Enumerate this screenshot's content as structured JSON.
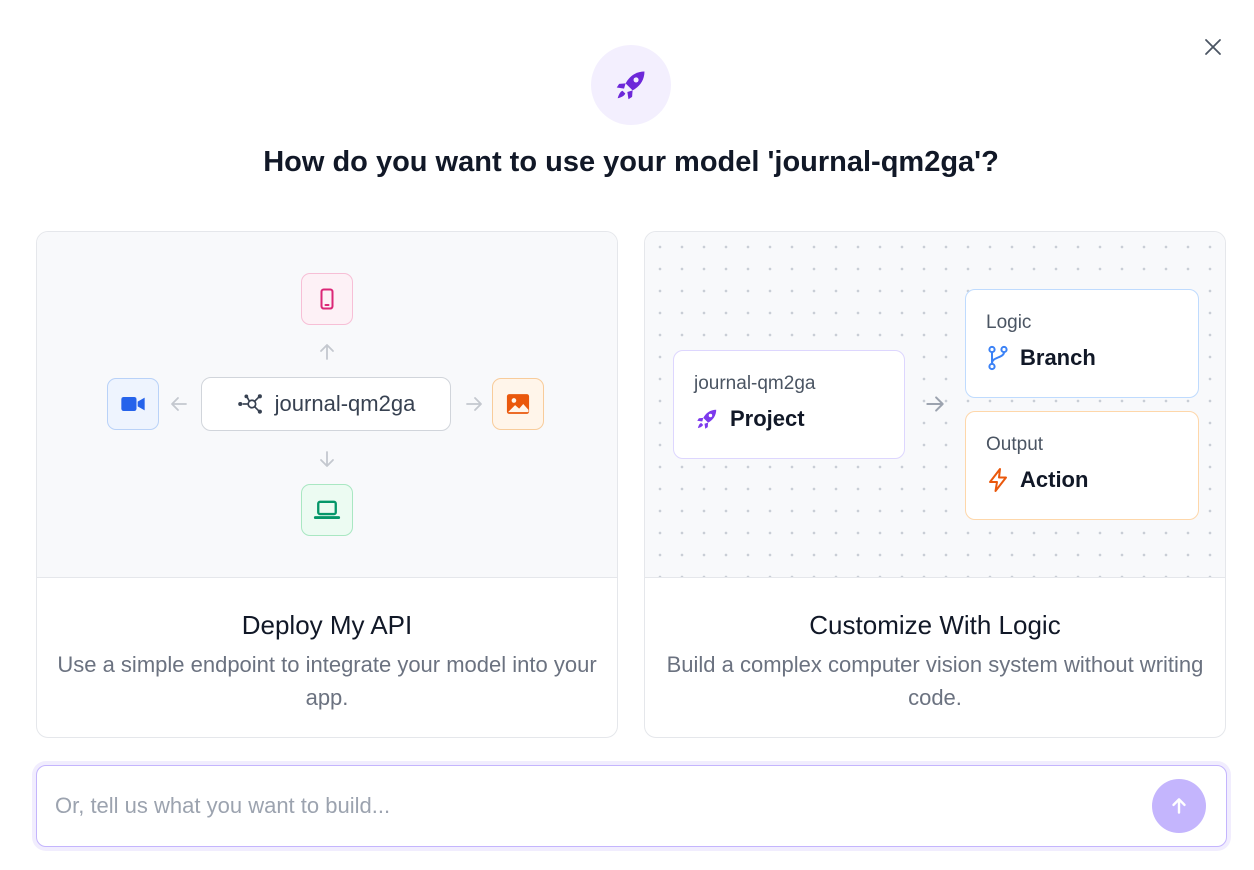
{
  "dialog": {
    "title": "How do you want to use your model 'journal-qm2ga'?",
    "icons": {
      "hero": "rocket-icon",
      "close": "close-icon"
    },
    "accent_color": "#6d28d9"
  },
  "cards": [
    {
      "title": "Deploy My API",
      "description": "Use a simple endpoint to integrate your model into your app.",
      "diagram": {
        "model_name": "journal-qm2ga",
        "targets": [
          "phone-icon",
          "video-camera-icon",
          "image-icon",
          "laptop-icon"
        ]
      }
    },
    {
      "title": "Customize With Logic",
      "description": "Build a complex computer vision system without writing code.",
      "diagram": {
        "project": {
          "subtitle": "journal-qm2ga",
          "label": "Project",
          "icon": "rocket-icon"
        },
        "branch": {
          "subtitle": "Logic",
          "label": "Branch",
          "icon": "git-branch-icon"
        },
        "action": {
          "subtitle": "Output",
          "label": "Action",
          "icon": "lightning-icon"
        }
      }
    }
  ],
  "chat": {
    "placeholder": "Or, tell us what you want to build...",
    "value": "",
    "send_icon": "arrow-up-icon"
  }
}
